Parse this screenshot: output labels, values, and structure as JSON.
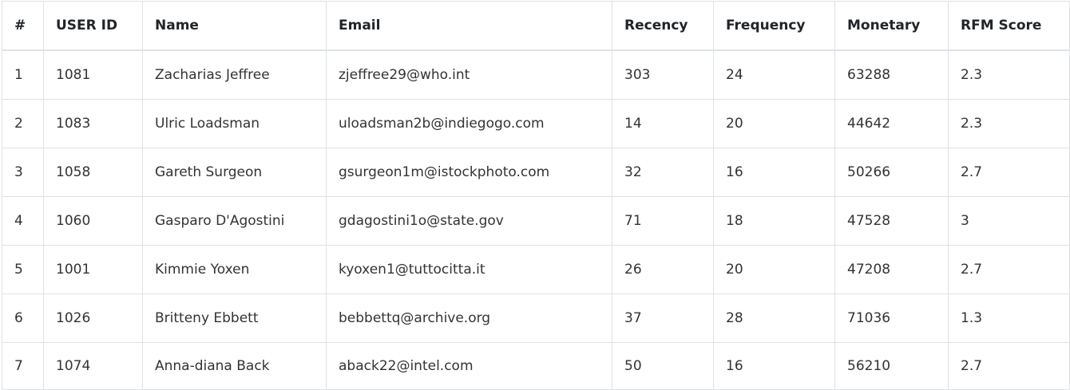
{
  "table": {
    "columns": [
      "#",
      "USER ID",
      "Name",
      "Email",
      "Recency",
      "Frequency",
      "Monetary",
      "RFM Score"
    ],
    "rows": [
      [
        "1",
        "1081",
        "Zacharias Jeffree",
        "zjeffree29@who.int",
        "303",
        "24",
        "63288",
        "2.3"
      ],
      [
        "2",
        "1083",
        "Ulric Loadsman",
        "uloadsman2b@indiegogo.com",
        "14",
        "20",
        "44642",
        "2.3"
      ],
      [
        "3",
        "1058",
        "Gareth Surgeon",
        "gsurgeon1m@istockphoto.com",
        "32",
        "16",
        "50266",
        "2.7"
      ],
      [
        "4",
        "1060",
        "Gasparo D'Agostini",
        "gdagostini1o@state.gov",
        "71",
        "18",
        "47528",
        "3"
      ],
      [
        "5",
        "1001",
        "Kimmie Yoxen",
        "kyoxen1@tuttocitta.it",
        "26",
        "20",
        "47208",
        "2.7"
      ],
      [
        "6",
        "1026",
        "Britteny Ebbett",
        "bebbettq@archive.org",
        "37",
        "28",
        "71036",
        "1.3"
      ],
      [
        "7",
        "1074",
        "Anna-diana Back",
        "aback22@intel.com",
        "50",
        "16",
        "56210",
        "2.7"
      ]
    ]
  }
}
